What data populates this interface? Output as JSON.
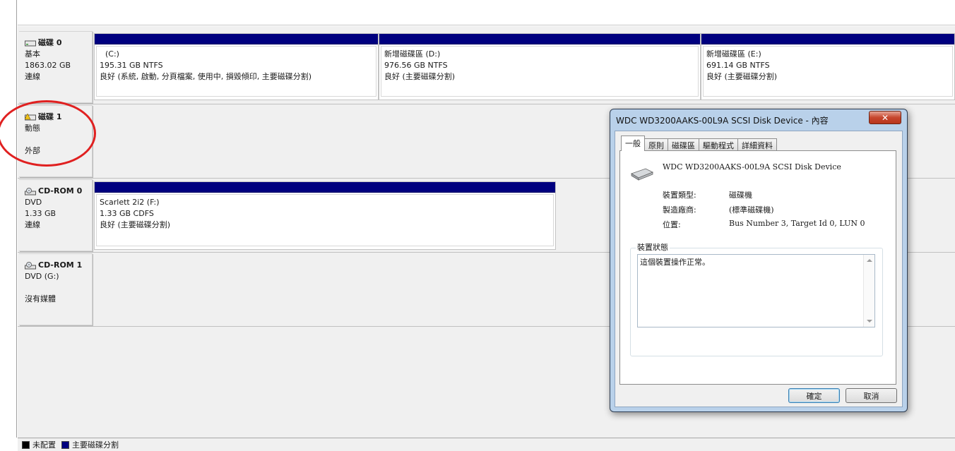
{
  "disks": [
    {
      "title": "磁碟 0",
      "type": "基本",
      "size": "1863.02 GB",
      "status": "連線",
      "icon": "hard-disk-icon"
    },
    {
      "title": "磁碟 1",
      "type": "動態",
      "size": "",
      "status": "外部",
      "icon": "dynamic-disk-warning-icon"
    },
    {
      "title": "CD-ROM 0",
      "type": "DVD",
      "size": "1.33 GB",
      "status": "連線",
      "icon": "cdrom-icon"
    },
    {
      "title": "CD-ROM 1",
      "type": "DVD (G:)",
      "size": "",
      "status": "沒有媒體",
      "icon": "cdrom-icon"
    }
  ],
  "partitions": {
    "c": {
      "name": "(C:)",
      "fs": "195.31 GB NTFS",
      "health": "良好 (系統, 啟動, 分頁檔案, 使用中, 損毀傾印, 主要磁碟分割)"
    },
    "d": {
      "name": "新增磁碟區 (D:)",
      "fs": "976.56 GB NTFS",
      "health": "良好 (主要磁碟分割)"
    },
    "e": {
      "name": "新增磁碟區 (E:)",
      "fs": "691.14 GB NTFS",
      "health": "良好 (主要磁碟分割)"
    },
    "f": {
      "name": "Scarlett 2i2 (F:)",
      "fs": "1.33 GB CDFS",
      "health": "良好 (主要磁碟分割)"
    }
  },
  "legend": {
    "unallocated": "未配置",
    "primary": "主要磁碟分割",
    "unallocated_color": "#000000",
    "primary_color": "#00007f"
  },
  "dialog": {
    "title": "WDC WD3200AAKS-00L9A SCSI Disk Device - 內容",
    "close": "✕",
    "tabs": [
      "一般",
      "原則",
      "磁碟區",
      "驅動程式",
      "詳細資料"
    ],
    "device_name": "WDC WD3200AAKS-00L9A SCSI Disk Device",
    "props": [
      {
        "label": "裝置類型:",
        "value": "磁碟機"
      },
      {
        "label": "製造廠商:",
        "value": "(標準磁碟機)"
      },
      {
        "label": "位置:",
        "value": "Bus Number 3, Target Id 0, LUN 0"
      }
    ],
    "status_group_title": "裝置狀態",
    "status_text": "這個裝置操作正常。",
    "ok": "確定",
    "cancel": "取消"
  },
  "colors": {
    "partition_bar": "#00007f",
    "annotation_circle": "#e02020"
  }
}
